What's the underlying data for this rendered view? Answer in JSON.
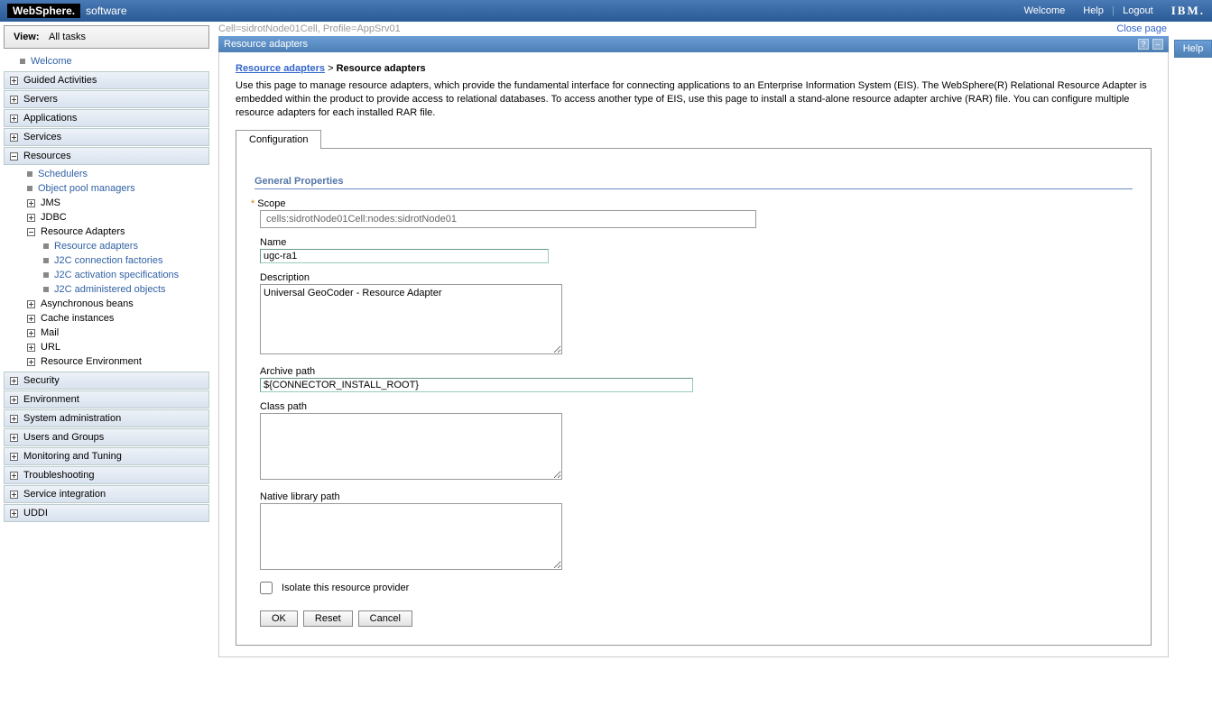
{
  "banner": {
    "ws_logo": "WebSphere.",
    "ws_sub": "software",
    "welcome": "Welcome",
    "help": "Help",
    "logout": "Logout",
    "ibm": "IBM."
  },
  "view_bar": {
    "label": "View:",
    "value": "All tasks"
  },
  "nav": {
    "welcome": "Welcome",
    "sections": {
      "guided": "Guided Activities",
      "servers": "Servers",
      "applications": "Applications",
      "services": "Services",
      "resources": "Resources",
      "security": "Security",
      "environment": "Environment",
      "sysadmin": "System administration",
      "users": "Users and Groups",
      "monitoring": "Monitoring and Tuning",
      "troubleshooting": "Troubleshooting",
      "service_int": "Service integration",
      "uddi": "UDDI"
    },
    "resources_children": {
      "schedulers": "Schedulers",
      "objpool": "Object pool managers",
      "jms": "JMS",
      "jdbc": "JDBC",
      "ra": "Resource Adapters",
      "async": "Asynchronous beans",
      "cache": "Cache instances",
      "mail": "Mail",
      "url": "URL",
      "resenv": "Resource Environment"
    },
    "ra_children": {
      "ra": "Resource adapters",
      "j2c_conn": "J2C connection factories",
      "j2c_act": "J2C activation specifications",
      "j2c_admin": "J2C administered objects"
    }
  },
  "content": {
    "cell_info": "Cell=sidrotNode01Cell, Profile=AppSrv01",
    "close_page": "Close page",
    "panel_title": "Resource adapters",
    "breadcrumb_link": "Resource adapters",
    "breadcrumb_sep": " > ",
    "breadcrumb_cur": "Resource adapters",
    "desc": "Use this page to manage resource adapters, which provide the fundamental interface for connecting applications to an Enterprise Information System (EIS). The WebSphere(R) Relational Resource Adapter is embedded within the product to provide access to relational databases. To access another type of EIS, use this page to install a stand-alone resource adapter archive (RAR) file. You can configure multiple resource adapters for each installed RAR file.",
    "tab": "Configuration",
    "gp_header": "General Properties",
    "labels": {
      "scope": "Scope",
      "name": "Name",
      "description": "Description",
      "archive": "Archive path",
      "classpath": "Class path",
      "native": "Native library path",
      "isolate": "Isolate this resource provider"
    },
    "values": {
      "scope": "cells:sidrotNode01Cell:nodes:sidrotNode01",
      "name": "ugc-ra1",
      "description": "Universal GeoCoder - Resource Adapter",
      "archive": "${CONNECTOR_INSTALL_ROOT}",
      "classpath": "",
      "native": ""
    },
    "buttons": {
      "ok": "OK",
      "reset": "Reset",
      "cancel": "Cancel"
    }
  },
  "help_tab": "Help",
  "panel_icons": {
    "help": "?",
    "min": "–"
  }
}
